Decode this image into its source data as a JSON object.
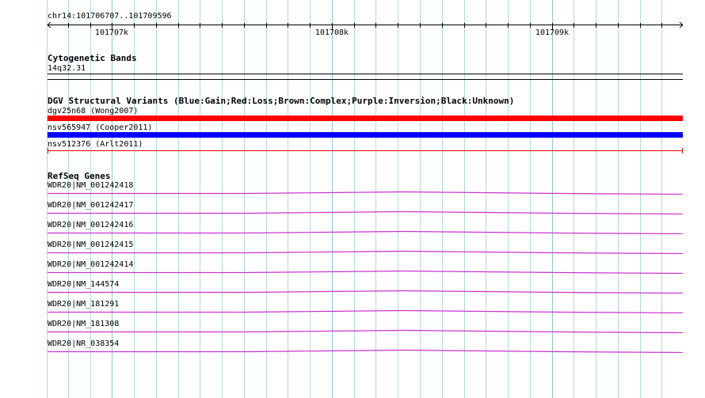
{
  "location": "chr14:101706707..101709596",
  "ruler": {
    "start": 101706707,
    "end": 101709596,
    "ticks": [
      {
        "pos": 101707000,
        "label": "101707k"
      },
      {
        "pos": 101708000,
        "label": "101708k"
      },
      {
        "pos": 101709000,
        "label": "101709k"
      }
    ]
  },
  "tracks": {
    "cytoband": {
      "title": "Cytogenetic Bands",
      "band": "14q32.31"
    },
    "dgv": {
      "title": "DGV Structural Variants (Blue:Gain;Red:Loss;Brown:Complex;Purple:Inversion;Black:Unknown)",
      "features": [
        {
          "label": "dgv25n68 (Wong2007)",
          "type": "Loss",
          "color": "#ff0000",
          "style": "thick"
        },
        {
          "label": "nsv565947 (Cooper2011)",
          "type": "Gain",
          "color": "#0000ff",
          "style": "thick"
        },
        {
          "label": "nsv512376 (Arlt2011)",
          "type": "Loss",
          "color": "#ff0000",
          "style": "thin"
        }
      ]
    },
    "refseq": {
      "title": "RefSeq Genes",
      "color": "#cc33cc",
      "genes": [
        "WDR20|NM_001242418",
        "WDR20|NM_001242417",
        "WDR20|NM_001242416",
        "WDR20|NM_001242415",
        "WDR20|NM_001242414",
        "WDR20|NM_144574",
        "WDR20|NM_181291",
        "WDR20|NM_181308",
        "WDR20|NR_038354"
      ]
    }
  },
  "colors": {
    "grid": "#add8e6",
    "ruler": "#000000"
  }
}
